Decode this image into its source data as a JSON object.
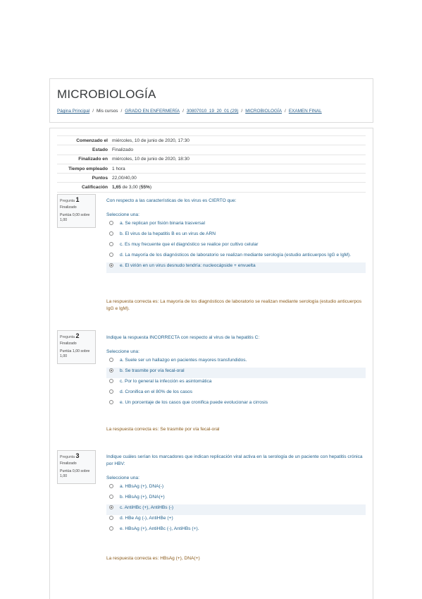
{
  "header": {
    "title": "MICROBIOLOGÍA",
    "breadcrumb": [
      {
        "label": "Página Principal",
        "link": true
      },
      {
        "label": "Mis cursos",
        "link": false
      },
      {
        "label": "GRADO EN ENFERMERÍA",
        "link": true
      },
      {
        "label": "30807010_19_20_01 (29)",
        "link": true
      },
      {
        "label": "MICROBIOLOGÍA",
        "link": true
      },
      {
        "label": "EXAMEN FINAL",
        "link": true
      }
    ],
    "separator": "/"
  },
  "summary": [
    {
      "key": "Comenzado el",
      "value": "miércoles, 10 de junio de 2020, 17:30"
    },
    {
      "key": "Estado",
      "value": "Finalizado"
    },
    {
      "key": "Finalizado en",
      "value": "miércoles, 10 de junio de 2020, 18:30"
    },
    {
      "key": "Tiempo empleado",
      "value": "1 hora"
    },
    {
      "key": "Puntos",
      "value": "22,00/40,00"
    },
    {
      "key": "Calificación",
      "value_bold": "1,65",
      "value_mid": " de 3,00 (",
      "value_pct": "55%",
      "value_end": ")"
    }
  ],
  "questions": [
    {
      "label": "Pregunta",
      "number": "1",
      "state": "Finalizado",
      "marks": "Puntúa 0,00 sobre 1,00",
      "text": "Con respecto a las características de los virus es CIERTO que:",
      "prompt": "Seleccione una:",
      "options": [
        {
          "text": "a. Se replican por fisión binaria trasversal",
          "checked": false
        },
        {
          "text": "b. El virus de la hepatitis B es un virus de ARN",
          "checked": false
        },
        {
          "text": "c. Es muy frecuente que el diagnóstico se realice por cultivo celular",
          "checked": false
        },
        {
          "text": "d. La mayoría de los diagnósticos de laboratorio se realizan mediante serología (estudio anticuerpos IgG e IgM).",
          "checked": false
        },
        {
          "text": "e. El virión en un virus desnudo tendría: nucleocápside + envuelta",
          "checked": true
        }
      ],
      "feedback": "La respuesta correcta es: La mayoría de los diagnósticos de laboratorio se realizan mediante serología (estudio anticuerpos IgG e IgM)."
    },
    {
      "label": "Pregunta",
      "number": "2",
      "state": "Finalizado",
      "marks": "Puntúa 1,00 sobre 1,00",
      "text": "Indique la respuesta INCORRECTA con respecto al virus de la hepatitis C:",
      "prompt": "Seleccione una:",
      "options": [
        {
          "text": "a. Suele ser un hallazgo en pacientes mayores transfundidos.",
          "checked": false
        },
        {
          "text": "b. Se trasmite por vía fecal-oral",
          "checked": true
        },
        {
          "text": "c. Por lo general la infección es asintomática",
          "checked": false
        },
        {
          "text": "d. Cronifica en el 80% de los casos",
          "checked": false
        },
        {
          "text": "e. Un porcentaje de los casos que cronifica puede evolucionar a cirrosis",
          "checked": false
        }
      ],
      "feedback": "La respuesta correcta es: Se trasmite por vía fecal-oral"
    },
    {
      "label": "Pregunta",
      "number": "3",
      "state": "Finalizado",
      "marks": "Puntúa 0,00 sobre 1,00",
      "text": "Indique cuáles serían los marcadores que indican replicación viral activa en la serología de un paciente con hepatitis crónica por HBV:",
      "prompt": "Seleccione una:",
      "options": [
        {
          "text": "a. HBsAg (+), DNA(-)",
          "checked": false
        },
        {
          "text": "b. HBsAg (+), DNA(+)",
          "checked": false
        },
        {
          "text": "c. AntiHBc (+), AntiHBs (-)",
          "checked": true
        },
        {
          "text": "d. HBe Ag (-), AntiHBe (+)",
          "checked": false
        },
        {
          "text": "e. HBsAg (+), AntiHBc (-), AntiHBs (+).",
          "checked": false
        }
      ],
      "feedback": "La respuesta correcta es: HBsAg (+), DNA(+)"
    }
  ]
}
